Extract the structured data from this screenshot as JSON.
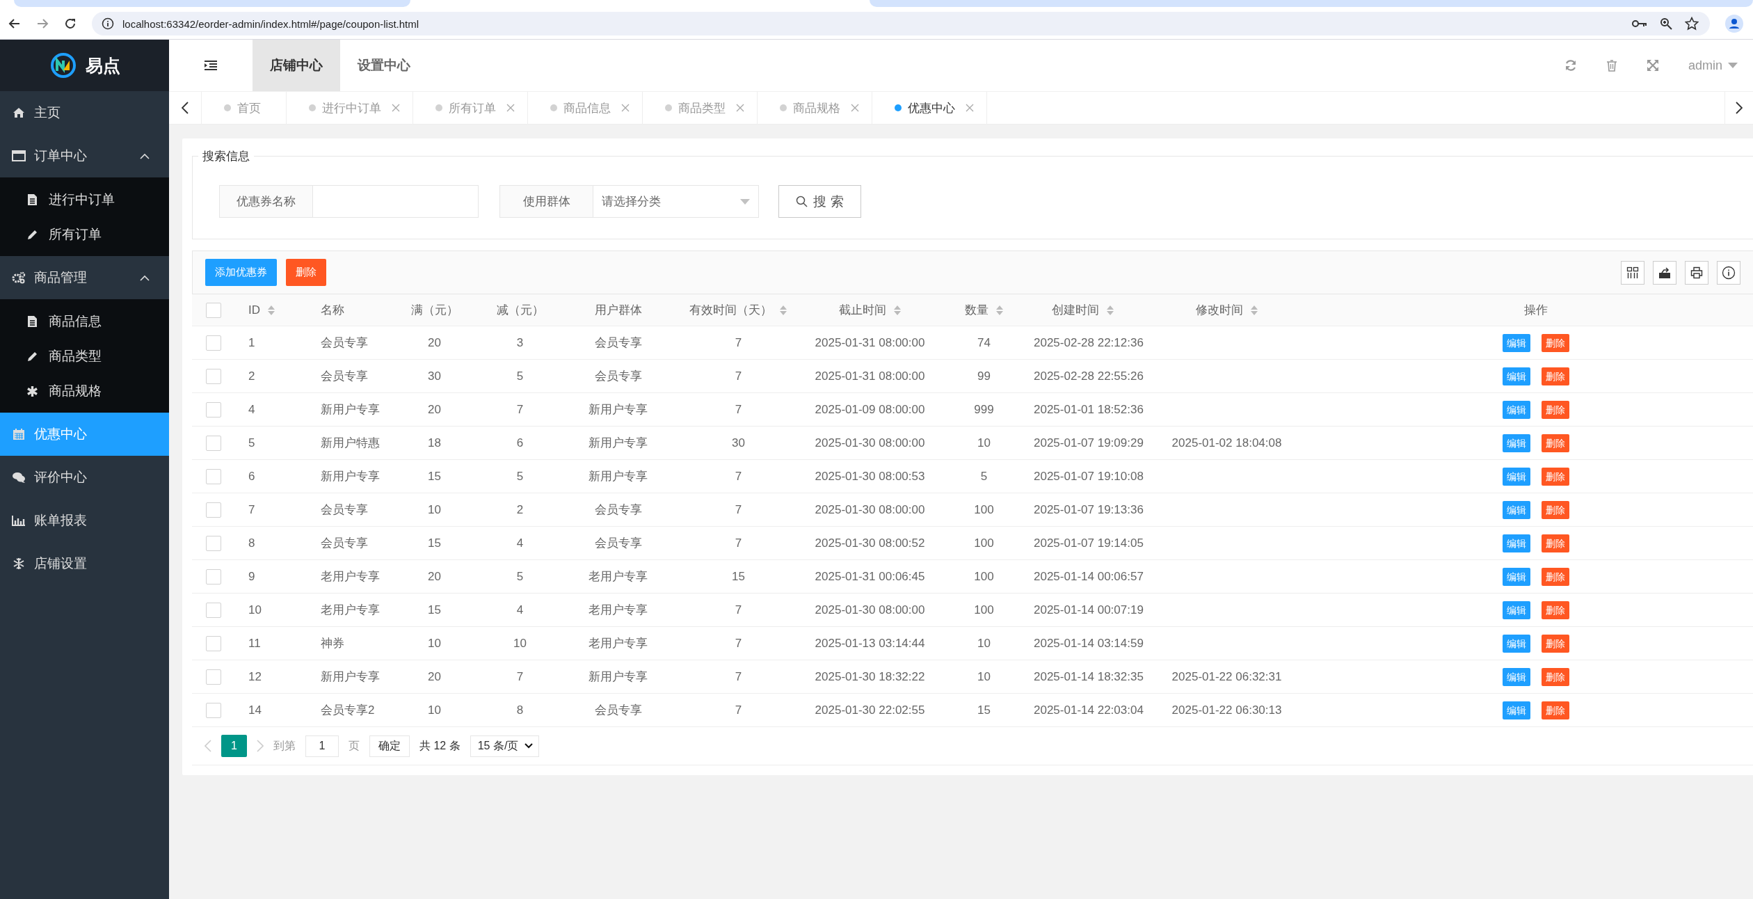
{
  "browser": {
    "url": "localhost:63342/eorder-admin/index.html#/page/coupon-list.html"
  },
  "logo": {
    "name": "易点"
  },
  "sidebar": {
    "items": [
      {
        "label": "主页",
        "selected": false
      },
      {
        "label": "订单中心",
        "selected": false,
        "expanded": true,
        "children": [
          {
            "label": "进行中订单",
            "selected": false
          },
          {
            "label": "所有订单",
            "selected": false
          }
        ]
      },
      {
        "label": "商品管理",
        "selected": false,
        "expanded": true,
        "children": [
          {
            "label": "商品信息",
            "selected": false
          },
          {
            "label": "商品类型",
            "selected": false
          },
          {
            "label": "商品规格",
            "selected": false
          }
        ]
      },
      {
        "label": "优惠中心",
        "selected": true
      },
      {
        "label": "评价中心",
        "selected": false
      },
      {
        "label": "账单报表",
        "selected": false
      },
      {
        "label": "店铺设置",
        "selected": false
      }
    ]
  },
  "header": {
    "nav": [
      {
        "label": "店铺中心",
        "selected": true
      },
      {
        "label": "设置中心",
        "selected": false
      }
    ],
    "user": "admin"
  },
  "tabs": [
    {
      "label": "首页",
      "selected": false,
      "closable": false
    },
    {
      "label": "进行中订单",
      "selected": false,
      "closable": true
    },
    {
      "label": "所有订单",
      "selected": false,
      "closable": true
    },
    {
      "label": "商品信息",
      "selected": false,
      "closable": true
    },
    {
      "label": "商品类型",
      "selected": false,
      "closable": true
    },
    {
      "label": "商品规格",
      "selected": false,
      "closable": true
    },
    {
      "label": "优惠中心",
      "selected": true,
      "closable": true
    }
  ],
  "search": {
    "legend": "搜索信息",
    "fields": [
      {
        "kind": "text",
        "label": "优惠券名称"
      },
      {
        "kind": "select",
        "label": "使用群体",
        "placeholder": "请选择分类"
      }
    ],
    "button": "搜 索"
  },
  "table": {
    "buttons": [
      {
        "label": "添加优惠券",
        "kind": "primary"
      },
      {
        "label": "删除",
        "kind": "danger"
      }
    ],
    "select_all": false,
    "columns": [
      {
        "label": "ID",
        "sortable": true
      },
      {
        "label": "名称",
        "sortable": false
      },
      {
        "label": "满（元）",
        "sortable": false
      },
      {
        "label": "减（元）",
        "sortable": false
      },
      {
        "label": "用户群体",
        "sortable": false
      },
      {
        "label": "有效时间（天）",
        "sortable": true
      },
      {
        "label": "截止时间",
        "sortable": true
      },
      {
        "label": "数量",
        "sortable": true
      },
      {
        "label": "创建时间",
        "sortable": true
      },
      {
        "label": "修改时间",
        "sortable": true
      },
      {
        "label": "操作",
        "sortable": false
      }
    ],
    "rows": [
      {
        "checked": false,
        "cells": [
          "1",
          "会员专享",
          "20",
          "3",
          "会员专享",
          "7",
          "2025-01-31 08:00:00",
          "74",
          "2025-02-28 22:12:36"
        ],
        "actions": [
          "编辑",
          "删除"
        ]
      },
      {
        "checked": false,
        "cells": [
          "2",
          "会员专享",
          "30",
          "5",
          "会员专享",
          "7",
          "2025-01-31 08:00:00",
          "99",
          "2025-02-28 22:55:26"
        ],
        "actions": [
          "编辑",
          "删除"
        ]
      },
      {
        "checked": false,
        "cells": [
          "4",
          "新用户专享",
          "20",
          "7",
          "新用户专享",
          "7",
          "2025-01-09 08:00:00",
          "999",
          "2025-01-01 18:52:36"
        ],
        "actions": [
          "编辑",
          "删除"
        ]
      },
      {
        "checked": false,
        "cells": [
          "5",
          "新用户特惠",
          "18",
          "6",
          "新用户专享",
          "30",
          "2025-01-30 08:00:00",
          "10",
          "2025-01-07 19:09:29",
          "2025-01-02 18:04:08"
        ],
        "actions": [
          "编辑",
          "删除"
        ]
      },
      {
        "checked": false,
        "cells": [
          "6",
          "新用户专享",
          "15",
          "5",
          "新用户专享",
          "7",
          "2025-01-30 08:00:53",
          "5",
          "2025-01-07 19:10:08"
        ],
        "actions": [
          "编辑",
          "删除"
        ]
      },
      {
        "checked": false,
        "cells": [
          "7",
          "会员专享",
          "10",
          "2",
          "会员专享",
          "7",
          "2025-01-30 08:00:00",
          "100",
          "2025-01-07 19:13:36"
        ],
        "actions": [
          "编辑",
          "删除"
        ]
      },
      {
        "checked": false,
        "cells": [
          "8",
          "会员专享",
          "15",
          "4",
          "会员专享",
          "7",
          "2025-01-30 08:00:52",
          "100",
          "2025-01-07 19:14:05"
        ],
        "actions": [
          "编辑",
          "删除"
        ]
      },
      {
        "checked": false,
        "cells": [
          "9",
          "老用户专享",
          "20",
          "5",
          "老用户专享",
          "15",
          "2025-01-31 00:06:45",
          "100",
          "2025-01-14 00:06:57"
        ],
        "actions": [
          "编辑",
          "删除"
        ]
      },
      {
        "checked": false,
        "cells": [
          "10",
          "老用户专享",
          "15",
          "4",
          "老用户专享",
          "7",
          "2025-01-30 08:00:00",
          "100",
          "2025-01-14 00:07:19"
        ],
        "actions": [
          "编辑",
          "删除"
        ]
      },
      {
        "checked": false,
        "cells": [
          "11",
          "神券",
          "10",
          "10",
          "老用户专享",
          "7",
          "2025-01-13 03:14:44",
          "10",
          "2025-01-14 03:14:59"
        ],
        "actions": [
          "编辑",
          "删除"
        ]
      },
      {
        "checked": false,
        "cells": [
          "12",
          "新用户专享",
          "20",
          "7",
          "新用户专享",
          "7",
          "2025-01-30 18:32:22",
          "10",
          "2025-01-14 18:32:35",
          "2025-01-22 06:32:31"
        ],
        "actions": [
          "编辑",
          "删除"
        ]
      },
      {
        "checked": false,
        "cells": [
          "14",
          "会员专享2",
          "10",
          "8",
          "会员专享",
          "7",
          "2025-01-30 22:02:55",
          "15",
          "2025-01-14 22:03:04",
          "2025-01-22 06:30:13"
        ],
        "actions": [
          "编辑",
          "删除"
        ]
      }
    ]
  },
  "pager": {
    "pages": [
      {
        "label": "1",
        "selected": true
      }
    ],
    "goto_label": "到第",
    "page_input": "1",
    "page_unit": "页",
    "confirm": "确定",
    "total": "共 12 条",
    "page_size": "15 条/页"
  }
}
